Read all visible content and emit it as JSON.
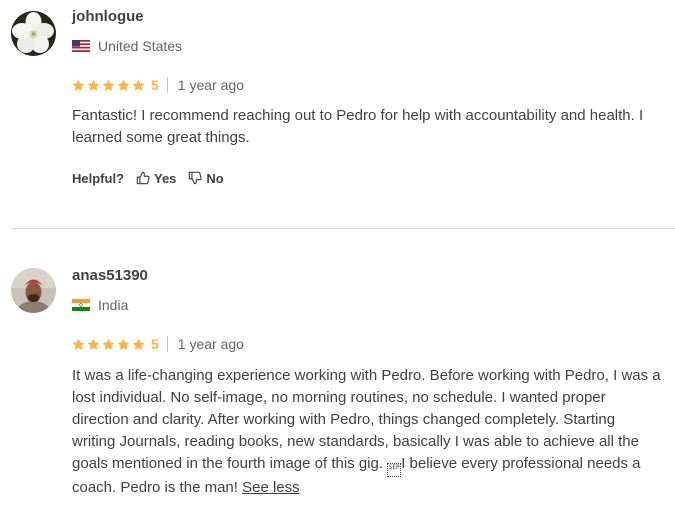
{
  "reviews": [
    {
      "username": "johnlogue",
      "country": "United States",
      "rating": "5",
      "time": "1 year ago",
      "text": "Fantastic! I recommend reaching out to Pedro for help with accountability and health. I learned some great things.",
      "helpful_label": "Helpful?",
      "yes_label": "Yes",
      "no_label": "No"
    },
    {
      "username": "anas51390",
      "country": "India",
      "rating": "5",
      "time": "1 year ago",
      "text_part1": "It was a life-changing experience working with Pedro. Before working with Pedro, I was a lost individual. No self-image, no morning routines, no schedule. I wanted proper direction and clarity. After working with Pedro, things changed completely. Starting writing Journals, reading books, new standards, basically I was able to achieve all the goals mentioned in the fourth image of this gig. ",
      "separator_glyph": "SEP",
      "text_part2": "I believe every professional needs a coach. Pedro is the man! ",
      "see_less_label": "See less"
    }
  ],
  "colors": {
    "star": "#ffb33e",
    "text": "#404145",
    "muted": "#62646a",
    "divider": "#dadbdd"
  },
  "icons": [
    "flower-avatar",
    "person-avatar",
    "us-flag-icon",
    "india-flag-icon",
    "star-icon",
    "thumbs-up-icon",
    "thumbs-down-icon"
  ]
}
